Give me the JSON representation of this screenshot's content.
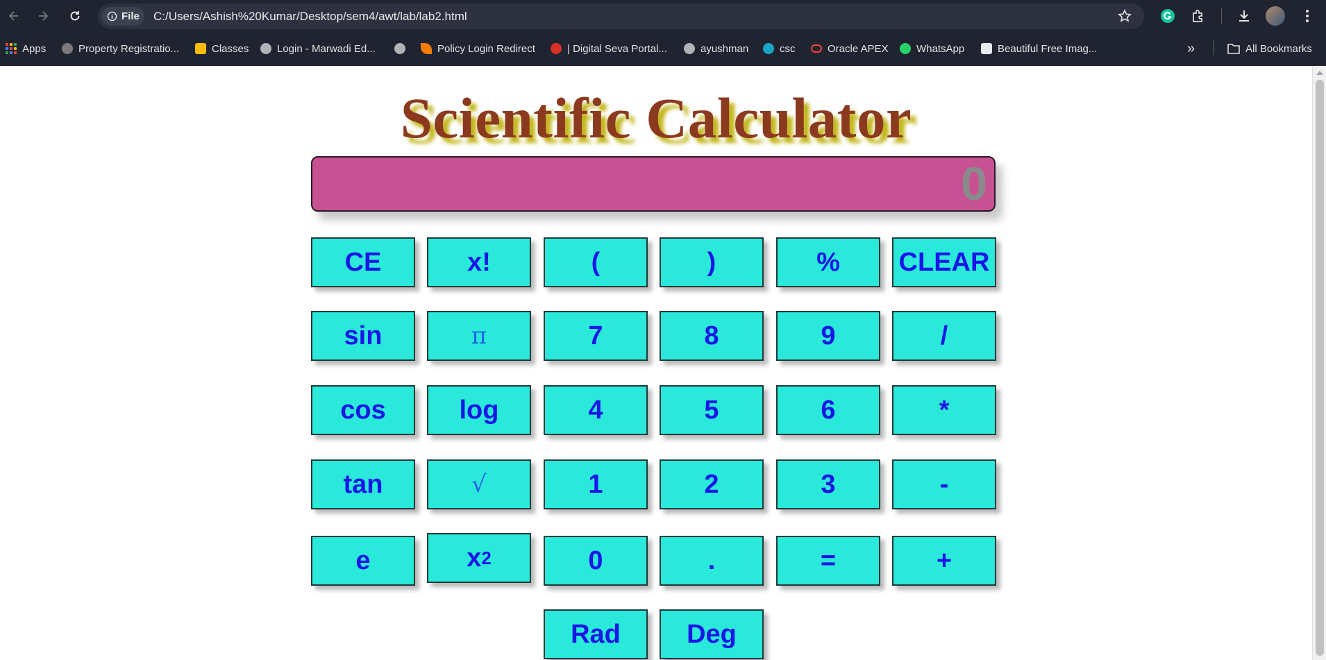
{
  "browser": {
    "site_chip": "File",
    "url": "C:/Users/Ashish%20Kumar/Desktop/sem4/awt/lab/lab2.html",
    "bookmarks": [
      {
        "label": "Apps"
      },
      {
        "label": "Property Registratio..."
      },
      {
        "label": "Classes"
      },
      {
        "label": "Login - Marwadi Ed..."
      },
      {
        "label": ""
      },
      {
        "label": "Policy Login Redirect"
      },
      {
        "label": "| Digital Seva Portal..."
      },
      {
        "label": "ayushman"
      },
      {
        "label": "csc"
      },
      {
        "label": "Oracle APEX"
      },
      {
        "label": "WhatsApp"
      },
      {
        "label": "Beautiful Free Imag..."
      }
    ],
    "more_label": "»",
    "all_bookmarks": "All Bookmarks"
  },
  "calculator": {
    "title": "Scientific Calculator",
    "display": "0",
    "rows": [
      [
        "CE",
        "x!",
        "(",
        ")",
        "%",
        "CLEAR"
      ],
      [
        "sin",
        "π",
        "7",
        "8",
        "9",
        "/"
      ],
      [
        "cos",
        "log",
        "4",
        "5",
        "6",
        "*"
      ],
      [
        "tan",
        "√",
        "1",
        "2",
        "3",
        "-"
      ],
      [
        "e",
        "x2",
        "0",
        ".",
        "=",
        "+"
      ],
      [
        "Rad",
        "Deg"
      ]
    ],
    "square_base": "x",
    "square_exp": "2",
    "accent_colors": {
      "button_bg": "#2ae8da",
      "button_text": "#1a16e6",
      "display_bg": "#c75293",
      "title": "#8b3a20",
      "title_shadow": "#c2b61c"
    }
  }
}
